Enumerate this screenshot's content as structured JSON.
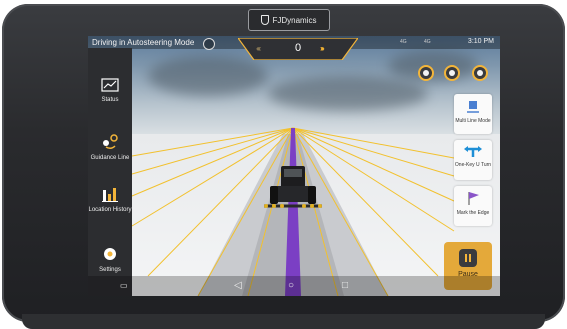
{
  "device": {
    "brand": "FJDynamics"
  },
  "status_bar": {
    "mode_text": "Driving in Autosteering Mode",
    "time": "3:10 PM",
    "signal_1": "4G",
    "signal_2": "4G"
  },
  "steering": {
    "value": "0"
  },
  "sidebar": {
    "items": [
      {
        "label": "Status",
        "icon": "chart-icon"
      },
      {
        "label": "Guidance Line",
        "icon": "pin-route-icon"
      },
      {
        "label": "Location History",
        "icon": "bar-chart-icon"
      },
      {
        "label": "Settings",
        "icon": "gear-icon"
      }
    ]
  },
  "right_panel": {
    "cards": [
      {
        "label": "Multi Line Mode",
        "icon": "multi-line-icon"
      },
      {
        "label": "One-Key U Turn",
        "icon": "u-turn-icon"
      },
      {
        "label": "Mark the Edge",
        "icon": "flag-icon"
      }
    ],
    "pause_label": "Pause"
  },
  "top_buttons": [
    "layers-icon",
    "brightness-icon",
    "target-icon"
  ],
  "colors": {
    "accent": "#f3b53a",
    "guide_line": "#f2c12e",
    "path": "#7b3fc4"
  }
}
